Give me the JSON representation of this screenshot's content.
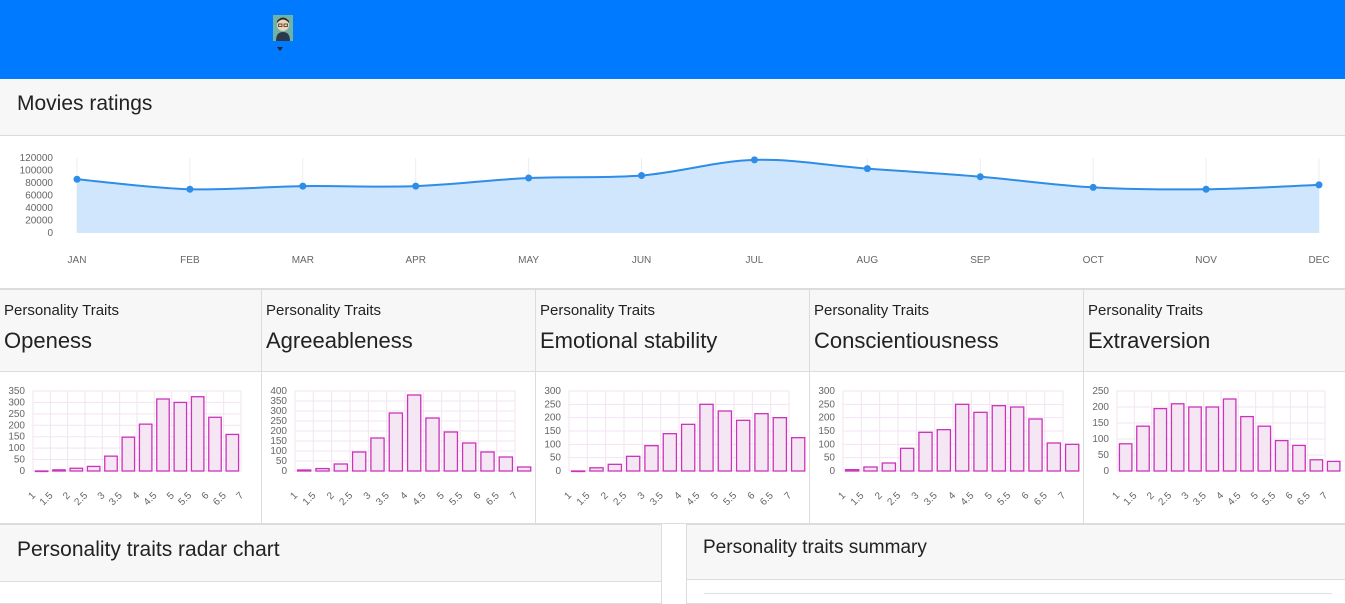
{
  "header": {
    "avatar_icon": "user-avatar-icon",
    "caret_icon": "caret-down-icon",
    "background": "#007bff"
  },
  "movies": {
    "title": "Movies ratings",
    "chart_data": {
      "type": "area",
      "categories": [
        "JAN",
        "FEB",
        "MAR",
        "APR",
        "MAY",
        "JUN",
        "JUL",
        "AUG",
        "SEP",
        "OCT",
        "NOV",
        "DEC"
      ],
      "values": [
        86000,
        70000,
        75000,
        75000,
        88000,
        92000,
        117000,
        103000,
        90000,
        73000,
        70000,
        77000
      ],
      "yticks": [
        "120000",
        "100000",
        "80000",
        "60000",
        "40000",
        "20000",
        "0"
      ],
      "ylim": [
        0,
        120000
      ],
      "line_color": "#2e8de6",
      "fill_color": "#cfe6fd"
    }
  },
  "traits": [
    {
      "subtitle": "Personality Traits",
      "name": "Openess",
      "chart_data": {
        "type": "bar",
        "categories": [
          "1",
          "1.5",
          "2",
          "2.5",
          "3",
          "3.5",
          "4",
          "4.5",
          "5",
          "5.5",
          "6",
          "6.5",
          "7"
        ],
        "yticks": [
          "350",
          "300",
          "250",
          "200",
          "150",
          "100",
          "50",
          "0"
        ],
        "ylim": [
          0,
          350
        ],
        "values": [
          0,
          5,
          12,
          20,
          65,
          148,
          205,
          315,
          300,
          325,
          235,
          160
        ]
      }
    },
    {
      "subtitle": "Personality Traits",
      "name": "Agreeableness",
      "chart_data": {
        "type": "bar",
        "categories": [
          "1",
          "1.5",
          "2",
          "2.5",
          "3",
          "3.5",
          "4",
          "4.5",
          "5",
          "5.5",
          "6",
          "6.5",
          "7"
        ],
        "yticks": [
          "400",
          "350",
          "300",
          "250",
          "200",
          "150",
          "100",
          "50",
          "0"
        ],
        "ylim": [
          0,
          400
        ],
        "values": [
          5,
          12,
          35,
          95,
          165,
          290,
          380,
          265,
          195,
          140,
          95,
          70,
          20
        ]
      }
    },
    {
      "subtitle": "Personality Traits",
      "name": "Emotional stability",
      "chart_data": {
        "type": "bar",
        "categories": [
          "1",
          "1.5",
          "2",
          "2.5",
          "3",
          "3.5",
          "4",
          "4.5",
          "5",
          "5.5",
          "6",
          "6.5",
          "7"
        ],
        "yticks": [
          "300",
          "250",
          "200",
          "150",
          "100",
          "50",
          "0"
        ],
        "ylim": [
          0,
          300
        ],
        "values": [
          0,
          12,
          25,
          55,
          95,
          140,
          175,
          250,
          225,
          190,
          215,
          200,
          125
        ]
      }
    },
    {
      "subtitle": "Personality Traits",
      "name": "Conscientiousness",
      "chart_data": {
        "type": "bar",
        "categories": [
          "1",
          "1.5",
          "2",
          "2.5",
          "3",
          "3.5",
          "4",
          "4.5",
          "5",
          "5.5",
          "6",
          "6.5",
          "7"
        ],
        "yticks": [
          "300",
          "250",
          "200",
          "150",
          "100",
          "50",
          "0"
        ],
        "ylim": [
          0,
          300
        ],
        "values": [
          5,
          15,
          30,
          85,
          145,
          155,
          250,
          220,
          245,
          240,
          195,
          105,
          100
        ]
      }
    },
    {
      "subtitle": "Personality Traits",
      "name": "Extraversion",
      "chart_data": {
        "type": "bar",
        "categories": [
          "1",
          "1.5",
          "2",
          "2.5",
          "3",
          "3.5",
          "4",
          "4.5",
          "5",
          "5.5",
          "6",
          "6.5",
          "7"
        ],
        "yticks": [
          "250",
          "200",
          "150",
          "100",
          "50",
          "0"
        ],
        "ylim": [
          0,
          250
        ],
        "values": [
          85,
          140,
          195,
          210,
          200,
          200,
          225,
          170,
          140,
          95,
          80,
          35,
          30
        ]
      }
    }
  ],
  "bar_colors": {
    "stroke": "#cc33bb",
    "fill": "#f4e6f2"
  },
  "radar": {
    "title": "Personality traits radar chart"
  },
  "summary": {
    "title": "Personality traits summary"
  }
}
